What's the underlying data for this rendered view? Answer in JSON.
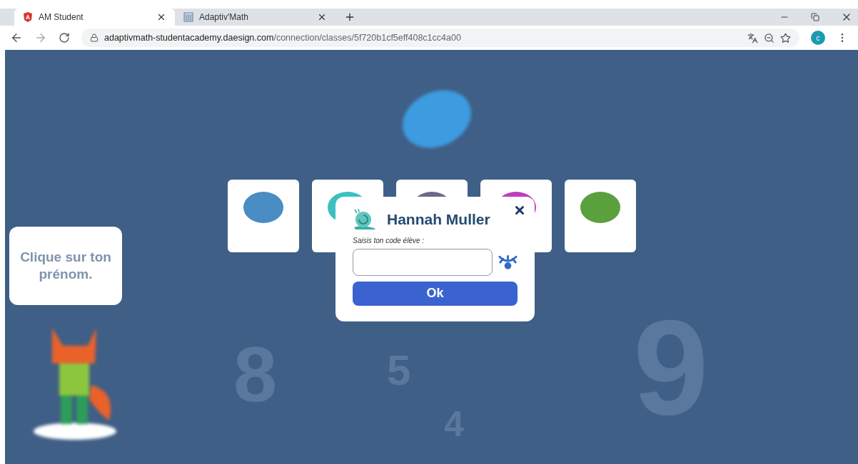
{
  "tabs": [
    {
      "label": "AM Student",
      "selected": true,
      "kind": "angular"
    },
    {
      "label": "Adaptiv'Math",
      "selected": false,
      "kind": "grid"
    }
  ],
  "address": {
    "domain": "adaptivmath-studentacademy.daesign.com",
    "path": "/connection/classes/5f720b1cf5eff408c1cc4a00"
  },
  "profile": {
    "initial": "c"
  },
  "background": {
    "bubble": "Clique sur ton prénom.",
    "digits": [
      "8",
      "5",
      "4",
      "9"
    ],
    "cards": [
      {
        "color": "#4a8cc4"
      },
      {
        "color": "#3cc0c0"
      },
      {
        "color": "#6a6a8a"
      },
      {
        "color": "#c03cc0"
      },
      {
        "color": "#5aa03c"
      }
    ]
  },
  "dialog": {
    "title": "Hannah Muller",
    "prompt": "Saisis ton code élève :",
    "button": "Ok"
  }
}
